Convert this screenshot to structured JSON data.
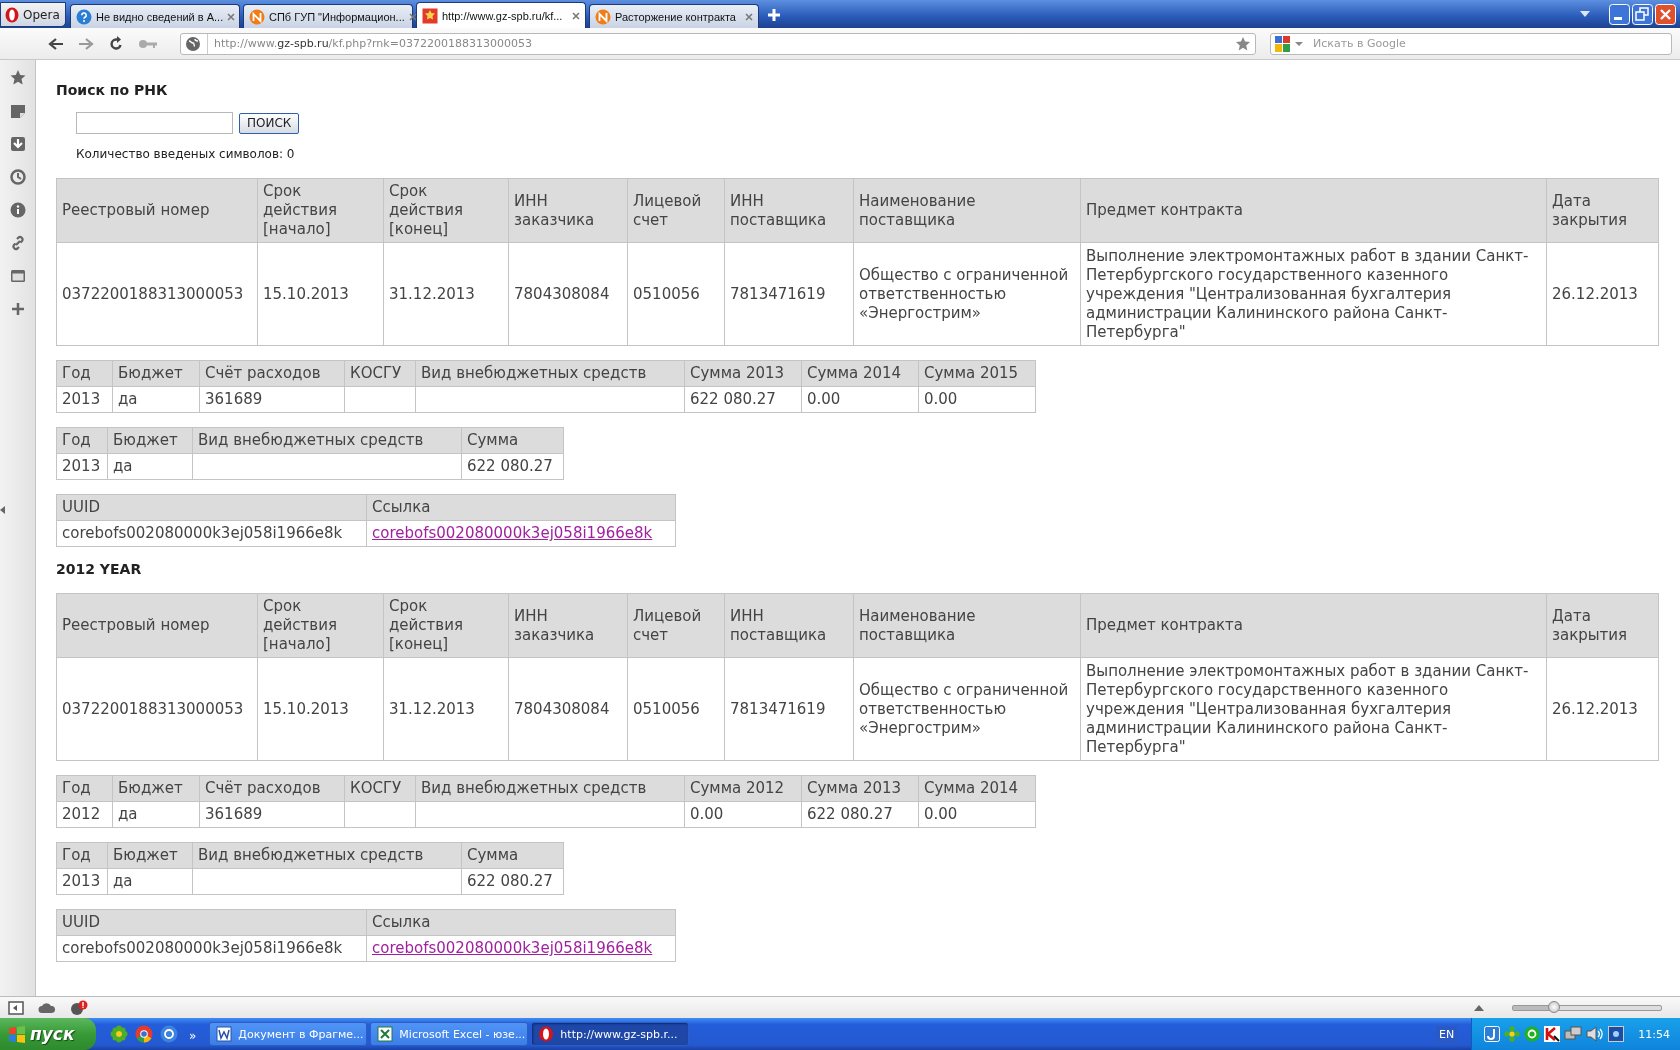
{
  "browser": {
    "menu_button": "Opera",
    "tabs": [
      {
        "title": "Не видно сведений в А...",
        "kind": "help",
        "selected": false
      },
      {
        "title": "СПб ГУП \"Информацион...",
        "kind": "logo",
        "selected": false
      },
      {
        "title": "http://www.gz-spb.ru/kf...",
        "kind": "flag",
        "selected": true
      },
      {
        "title": "Расторжение контракта",
        "kind": "logo",
        "selected": false
      }
    ],
    "address": {
      "scheme": "http://www.",
      "domain": "gz-spb.ru",
      "path": "/kf.php?rnk=0372200188313000053"
    },
    "search": {
      "placeholder": "Искать в Google"
    }
  },
  "page": {
    "title": "Поиск по РНК",
    "search_button": "ПОИСК",
    "counter": "Количество введеных символов: 0",
    "sections": [
      {
        "tables": [
          {
            "kind": "contract",
            "columns": [
              "Реестровый номер",
              "Срок действия [начало]",
              "Срок действия [конец]",
              "ИНН заказчика",
              "Лицевой счет",
              "ИНН поставщика",
              "Наименование поставщика",
              "Предмет контракта",
              "Дата закрытия"
            ],
            "rows": [
              [
                "0372200188313000053",
                "15.10.2013",
                "31.12.2013",
                "7804308084",
                "0510056",
                "7813471619",
                "Общество с ограниченной ответственностью «Энергострим»",
                "Выполнение электромонтажных работ в здании Санкт-Петербургского государственного казенного учреждения \"Централизованная бухгалтерия администрации Калининского района Санкт-Петербурга\"",
                "26.12.2013"
              ]
            ]
          },
          {
            "kind": "budget",
            "columns": [
              "Год",
              "Бюджет",
              "Счёт расходов",
              "КОСГУ",
              "Вид внебюджетных средств",
              "Сумма 2013",
              "Сумма 2014",
              "Сумма 2015"
            ],
            "rows": [
              [
                "2013",
                "да",
                "361689",
                null,
                null,
                "622 080.27",
                "0.00",
                "0.00"
              ]
            ]
          },
          {
            "kind": "funds",
            "columns": [
              "Год",
              "Бюджет",
              "Вид внебюджетных средств",
              "Сумма"
            ],
            "rows": [
              [
                "2013",
                "да",
                null,
                "622 080.27"
              ]
            ]
          },
          {
            "kind": "links",
            "columns": [
              "UUID",
              "Ссылка"
            ],
            "rows": [
              [
                "corebofs002080000k3ej058i1966e8k",
                "corebofs002080000k3ej058i1966e8k"
              ]
            ]
          }
        ]
      },
      {
        "heading": "2012 YEAR",
        "tables": [
          {
            "kind": "contract",
            "columns": [
              "Реестровый номер",
              "Срок действия [начало]",
              "Срок действия [конец]",
              "ИНН заказчика",
              "Лицевой счет",
              "ИНН поставщика",
              "Наименование поставщика",
              "Предмет контракта",
              "Дата закрытия"
            ],
            "rows": [
              [
                "0372200188313000053",
                "15.10.2013",
                "31.12.2013",
                "7804308084",
                "0510056",
                "7813471619",
                "Общество с ограниченной ответственностью «Энергострим»",
                "Выполнение электромонтажных работ в здании Санкт-Петербургского государственного казенного учреждения \"Централизованная бухгалтерия администрации Калининского района Санкт-Петербурга\"",
                "26.12.2013"
              ]
            ]
          },
          {
            "kind": "budget",
            "columns": [
              "Год",
              "Бюджет",
              "Счёт расходов",
              "КОСГУ",
              "Вид внебюджетных средств",
              "Сумма 2012",
              "Сумма 2013",
              "Сумма 2014"
            ],
            "rows": [
              [
                "2012",
                "да",
                "361689",
                null,
                null,
                "0.00",
                "622 080.27",
                "0.00"
              ]
            ]
          },
          {
            "kind": "funds",
            "columns": [
              "Год",
              "Бюджет",
              "Вид внебюджетных средств",
              "Сумма"
            ],
            "rows": [
              [
                "2013",
                "да",
                null,
                "622 080.27"
              ]
            ]
          },
          {
            "kind": "links",
            "columns": [
              "UUID",
              "Ссылка"
            ],
            "rows": [
              [
                "corebofs002080000k3ej058i1966e8k",
                "corebofs002080000k3ej058i1966e8k"
              ]
            ]
          }
        ]
      }
    ]
  },
  "status_bar": {
    "zoom": {
      "level": 0.28
    }
  },
  "taskbar": {
    "start": "пуск",
    "more": "»",
    "tasks": [
      {
        "title": "Документ в Фрагме...",
        "kind": "word",
        "selected": false
      },
      {
        "title": "Microsoft Excel - юзе...",
        "kind": "excel",
        "selected": false
      },
      {
        "title": "http://www.gz-spb.r...",
        "kind": "opera",
        "selected": true
      }
    ],
    "language": "EN",
    "clock": "11:54"
  }
}
